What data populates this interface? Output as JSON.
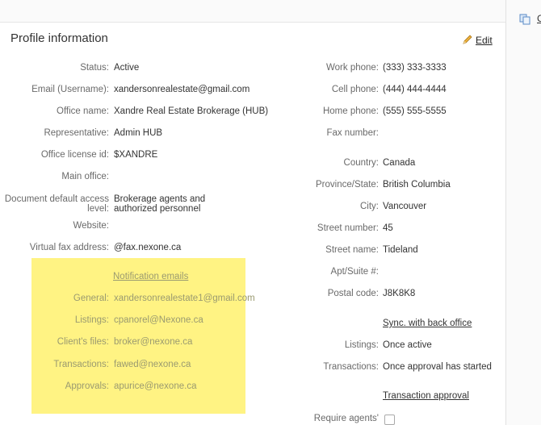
{
  "header": {
    "title": "Profile information",
    "edit_label": "Edit"
  },
  "side": {
    "link_label": "C"
  },
  "left_fields": [
    {
      "label": "Status:",
      "value": "Active"
    },
    {
      "label": "Email (Username):",
      "value": "xandersonrealestate@gmail.com"
    },
    {
      "label": "Office name:",
      "value": "Xandre Real Estate Brokerage (HUB)"
    },
    {
      "label": "Representative:",
      "value": "Admin HUB"
    },
    {
      "label": "Office license id:",
      "value": "$XANDRE"
    },
    {
      "label": "Main office:",
      "value": ""
    },
    {
      "label_line1": "Document default access",
      "label_line2": "level:",
      "value_line1": "Brokerage agents and",
      "value_line2": "authorized personnel"
    },
    {
      "label": "Website:",
      "value": ""
    },
    {
      "label": "Virtual fax address:",
      "value": "@fax.nexone.ca"
    }
  ],
  "notifications": {
    "heading": "Notification emails",
    "items": [
      {
        "label": "General:",
        "value": "xandersonrealestate1@gmail.com"
      },
      {
        "label": "Listings:",
        "value": "cpanorel@Nexone.ca"
      },
      {
        "label": "Client's files:",
        "value": "broker@nexone.ca"
      },
      {
        "label": "Transactions:",
        "value": "fawed@nexone.ca"
      },
      {
        "label": "Approvals:",
        "value": "apurice@nexone.ca"
      }
    ]
  },
  "right_fields": [
    {
      "label": "Work phone:",
      "value": "(333) 333-3333"
    },
    {
      "label": "Cell phone:",
      "value": "(444) 444-4444"
    },
    {
      "label": "Home phone:",
      "value": "(555) 555-5555"
    },
    {
      "label": "Fax number:",
      "value": ""
    },
    {
      "label": "Country:",
      "value": "Canada"
    },
    {
      "label": "Province/State:",
      "value": "British Columbia"
    },
    {
      "label": "City:",
      "value": "Vancouver"
    },
    {
      "label": "Street number:",
      "value": "45"
    },
    {
      "label": "Street name:",
      "value": "Tideland"
    },
    {
      "label": "Apt/Suite #:",
      "value": ""
    },
    {
      "label": "Postal code:",
      "value": "J8K8K8"
    }
  ],
  "sync": {
    "heading": "Sync. with back office",
    "listings_label": "Listings:",
    "listings_value": "Once active",
    "transactions_label": "Transactions:",
    "transactions_value": "Once approval has started"
  },
  "approval": {
    "heading": "Transaction approval",
    "require_label": "Require agents'"
  }
}
